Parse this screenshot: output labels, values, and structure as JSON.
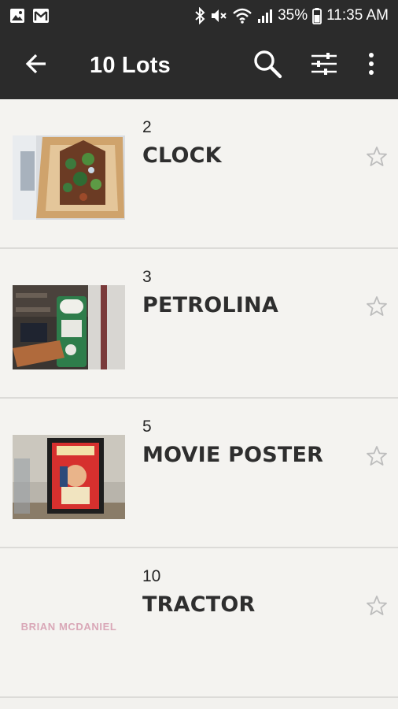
{
  "status_bar": {
    "battery_percent": "35%",
    "time": "11:35 AM",
    "left_icons": [
      "image-notification-icon",
      "gmail-notification-icon"
    ],
    "right_icons": [
      "bluetooth-icon",
      "mute-icon",
      "wifi-icon",
      "signal-icon",
      "battery-icon"
    ]
  },
  "app_bar": {
    "title": "10 Lots",
    "back_icon": "arrow-left-icon",
    "actions": [
      "search-icon",
      "filter-sliders-icon",
      "more-vertical-icon"
    ]
  },
  "lots": [
    {
      "number": "2",
      "name": "CLOCK",
      "thumb": "clock-photo",
      "starred": false
    },
    {
      "number": "3",
      "name": "PETROLINA",
      "thumb": "petrol-pump-photo",
      "starred": false
    },
    {
      "number": "5",
      "name": "MOVIE POSTER",
      "thumb": "movie-poster-photo",
      "starred": false
    },
    {
      "number": "10",
      "name": "TRACTOR",
      "thumb": "brian-mcdaniel-logo",
      "thumb_text": "BRIAN MCDANIEL",
      "starred": false
    }
  ],
  "colors": {
    "app_bar_bg": "#2b2b2b",
    "list_bg": "#f4f3f0",
    "divider": "#dcdbd8",
    "star_outline": "#bdbdbd"
  }
}
